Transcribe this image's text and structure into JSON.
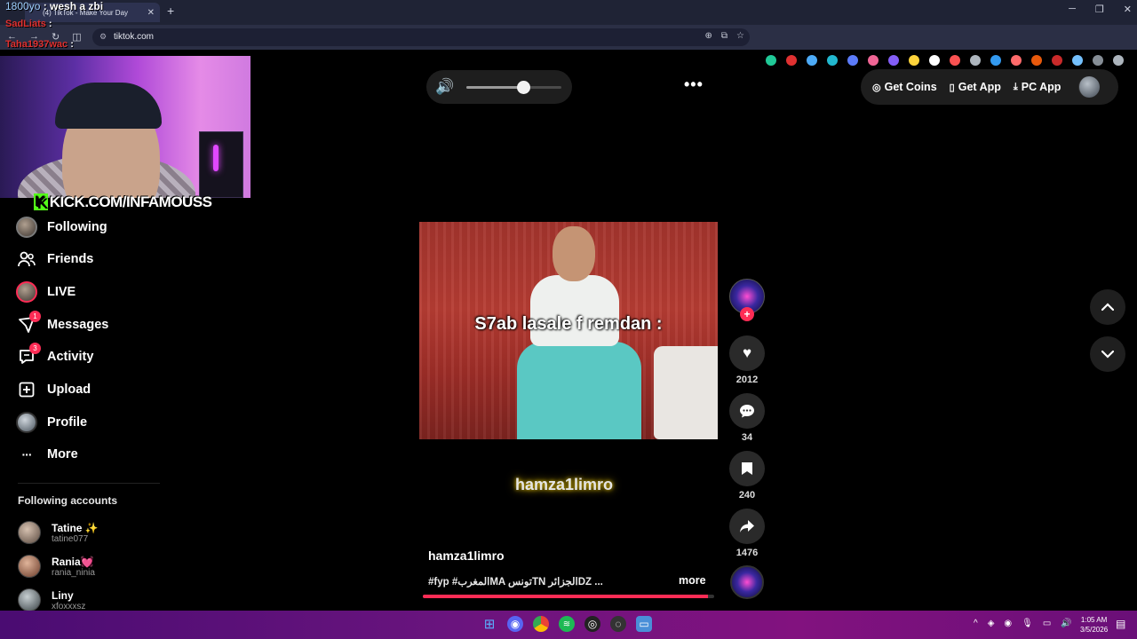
{
  "overlay": {
    "viewer_count": "1800yo",
    "stream_title": ": wesh a zbi",
    "chat": [
      {
        "user": "SadLiats",
        "colon": ":"
      },
      {
        "user": "Taha1937wac",
        "colon": ":"
      }
    ],
    "kick_url": "KICK.COM/INFAMOUSS"
  },
  "browser": {
    "tab_title": "(4) TikTok - Make Your Day",
    "tab_close": "✕",
    "new_tab": "+",
    "url": "tiktok.com",
    "window_controls": [
      "─",
      "❐",
      "✕"
    ]
  },
  "sidebar": {
    "items": [
      {
        "label": "Following",
        "icon": "following-avatar-icon"
      },
      {
        "label": "Friends",
        "icon": "friends-icon"
      },
      {
        "label": "LIVE",
        "icon": "live-avatar-icon"
      },
      {
        "label": "Messages",
        "icon": "messages-icon",
        "badge": "1"
      },
      {
        "label": "Activity",
        "icon": "activity-icon",
        "badge": "3"
      },
      {
        "label": "Upload",
        "icon": "upload-icon"
      },
      {
        "label": "Profile",
        "icon": "profile-avatar-icon"
      },
      {
        "label": "More",
        "icon": "more-icon"
      }
    ],
    "following_header": "Following accounts",
    "accounts": [
      {
        "name": "Tatine ✨",
        "handle": "tatine077"
      },
      {
        "name": "Rania💓",
        "handle": "rania_ninia"
      },
      {
        "name": "Liny",
        "handle": "xfoxxxsz"
      }
    ]
  },
  "topbar": {
    "volume_level": 0.6,
    "more": "•••",
    "get_coins": "Get Coins",
    "get_app": "Get App",
    "pc_app": "PC App"
  },
  "video": {
    "caption": "S7ab lasale f remdan :",
    "watermark": "hamza1limro",
    "author": "hamza1limro",
    "description": "#fyp #المغربMA تونسTN الجزائرDZ ...",
    "more_label": "more",
    "progress": 0.98
  },
  "actions": {
    "follow": "+",
    "likes": "2012",
    "comments": "34",
    "saves": "240",
    "shares": "1476"
  },
  "taskbar": {
    "time": "1:05 AM",
    "date": "3/5/2026"
  },
  "colors": {
    "accent": "#fe2c55",
    "kick": "#53fc18",
    "taskbar": "#6a147e"
  }
}
